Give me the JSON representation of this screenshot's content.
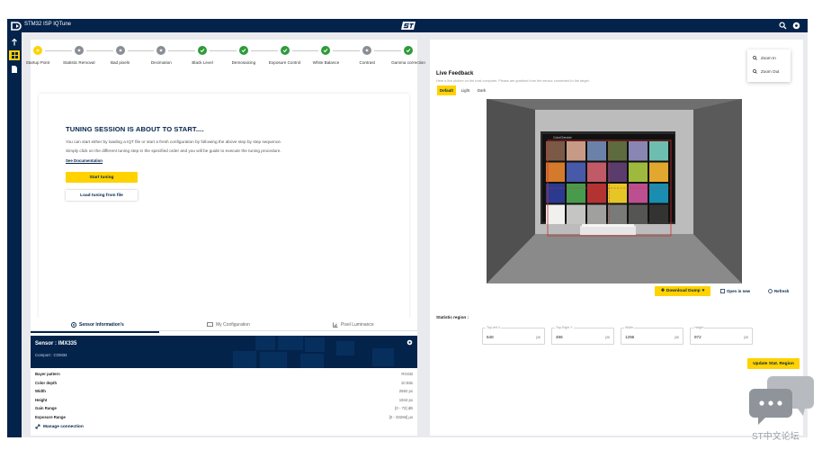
{
  "app": {
    "title": "STM32 ISP IQTune",
    "colors": {
      "navy": "#03234b",
      "yellow": "#ffd200",
      "green": "#2e9a3a",
      "grey": "#8a8f95"
    }
  },
  "topbar_icons": [
    "search-icon",
    "settings-icon"
  ],
  "sidebar": [
    "tune-icon",
    "dashboard-icon",
    "document-icon"
  ],
  "steps": [
    {
      "label": "Startup Point",
      "state": "current"
    },
    {
      "label": "Statistic Removal",
      "state": "pending"
    },
    {
      "label": "Bad pixels",
      "state": "pending"
    },
    {
      "label": "Decimation",
      "state": "pending"
    },
    {
      "label": "Black Level",
      "state": "done"
    },
    {
      "label": "Demosaicing",
      "state": "done"
    },
    {
      "label": "Exposure Control",
      "state": "done"
    },
    {
      "label": "White Balance",
      "state": "done"
    },
    {
      "label": "Contrast",
      "state": "pending"
    },
    {
      "label": "Gamma correction",
      "state": "done"
    }
  ],
  "tuning": {
    "title": "TUNING SESSION IS ABOUT TO START....",
    "para1": "You can start either by loading a IQT file or start a fresh configuration by following the above step by step sequence.",
    "para2": "Simply click on the different tuning step in the specified order and you will be guide to execute the tuning procedure.",
    "doc_link": "See Documentation",
    "start_btn": "Start tuning",
    "load_btn": "Load tuning from file"
  },
  "info_tabs": [
    "Sensor Information's",
    "My Configuration",
    "Pixel Luminance"
  ],
  "sensor": {
    "name": "Sensor : IMX335",
    "comport": "Comport : COM34",
    "rows": [
      {
        "key": "Bayer pattern",
        "value": "RGGB"
      },
      {
        "key": "Color depth",
        "value": "10 Bits"
      },
      {
        "key": "Width",
        "value": "2592 px"
      },
      {
        "key": "Height",
        "value": "1944 px"
      },
      {
        "key": "Gain Range",
        "value": "[0 - 72] dB"
      },
      {
        "key": "Exposure Range",
        "value": "[0 - 33266] µs"
      }
    ],
    "manage": "Manage connection"
  },
  "live": {
    "title": "Live Feedback",
    "subtitle": "Here a live picture on the host computer. Please are grabbed from the sensor connected to the target.",
    "modes": [
      "Default",
      "Light",
      "Dark"
    ],
    "active_mode": "Default",
    "download_btn": "Download Dump",
    "zoom_btn": "Open in new",
    "refresh_btn": "Refresh"
  },
  "zoom_menu": [
    "Zoom In",
    "Zoom Out"
  ],
  "stat_region": {
    "label": "Statistic region :",
    "fields": [
      {
        "label": "Top-left X",
        "value": "648",
        "unit": "px"
      },
      {
        "label": "Top-Right Y",
        "value": "486",
        "unit": "px"
      },
      {
        "label": "Width",
        "value": "1296",
        "unit": "px"
      },
      {
        "label": "Height",
        "value": "972",
        "unit": "px"
      }
    ],
    "update_btn": "Update Stat. Region"
  },
  "checker": [
    "#7a5a47",
    "#c79a86",
    "#6a82a8",
    "#5d6b3e",
    "#8a86b4",
    "#6dbeb0",
    "#d47a2c",
    "#4759a8",
    "#c05a66",
    "#5a3d6c",
    "#9dba3e",
    "#e1a72e",
    "#2b3a8e",
    "#489a4c",
    "#b33332",
    "#e6c626",
    "#bb4f8f",
    "#1a8eb0",
    "#f0f0ee",
    "#c5c5c4",
    "#a0a09f",
    "#7a7a79",
    "#555554",
    "#333332"
  ],
  "watermark": "ST中文论坛"
}
